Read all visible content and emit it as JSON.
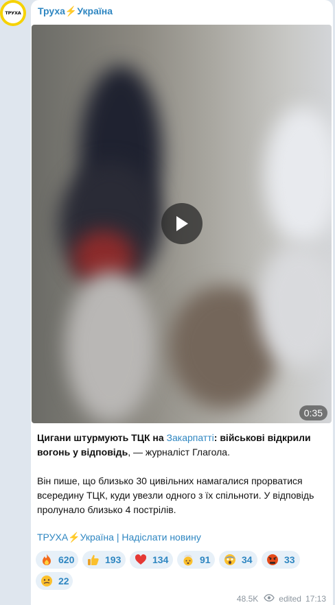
{
  "channel": {
    "name": "Труха⚡Україна",
    "avatar_text": "ТРУХА"
  },
  "video": {
    "duration": "0:35",
    "play_icon": "play-icon"
  },
  "post": {
    "headline_bold_1": "Цигани штурмують ТЦК на ",
    "headline_link": "Закарпатті",
    "headline_bold_2": ": військові відкрили вогонь у відповідь",
    "headline_rest": ", — журналіст Глагола.",
    "paragraph": "Він пише, що близько 30 цивільних намагалися прорватися всередину ТЦК, куди увезли одного з їх спільноти. У відповідь пролунало близько 4 пострілів.",
    "footer_link": "ТРУХА⚡Україна | Надіслати новину"
  },
  "reactions": [
    {
      "emoji": "fire-icon",
      "count": "620"
    },
    {
      "emoji": "thumbs-up-icon",
      "count": "193"
    },
    {
      "emoji": "heart-icon",
      "count": "134"
    },
    {
      "emoji": "exploding-head-icon",
      "count": "91"
    },
    {
      "emoji": "screaming-face-icon",
      "count": "34"
    },
    {
      "emoji": "angry-face-icon",
      "count": "33"
    },
    {
      "emoji": "grimacing-face-icon",
      "count": "22"
    }
  ],
  "meta": {
    "views": "48.5K",
    "edited_label": "edited",
    "time": "17:13"
  },
  "colors": {
    "accent": "#2e86c1",
    "background": "#dfe6ee",
    "reaction_bg": "#e7f0f8"
  }
}
